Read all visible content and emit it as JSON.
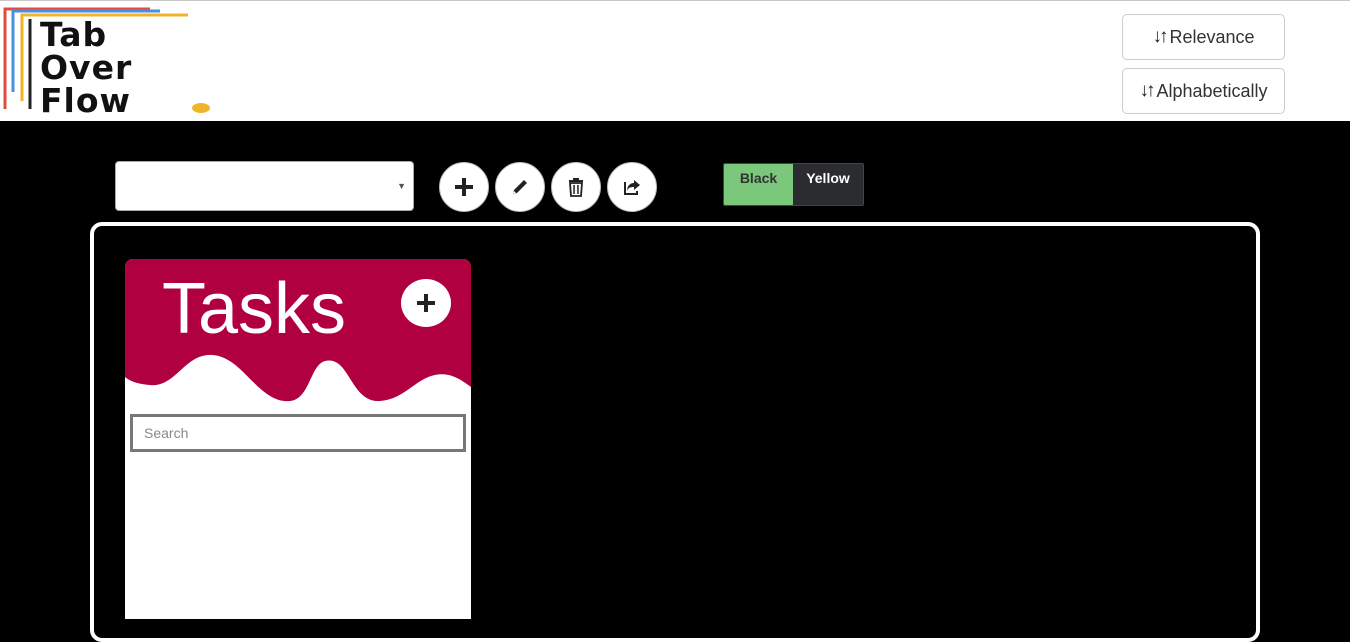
{
  "header": {
    "logo": {
      "line1": "Tab",
      "line2": "Over",
      "line3": "Flow",
      "dot_color": "#f0b429"
    },
    "sort_buttons": [
      {
        "label": "Relevance",
        "icon": "sort-icon"
      },
      {
        "label": "Alphabetically",
        "icon": "sort-icon"
      }
    ]
  },
  "toolbar": {
    "board_select": {
      "value": "",
      "icon": "chevron-down-icon"
    },
    "actions": [
      {
        "name": "add",
        "icon": "plus-icon"
      },
      {
        "name": "edit",
        "icon": "pencil-icon"
      },
      {
        "name": "delete",
        "icon": "trash-icon"
      },
      {
        "name": "share",
        "icon": "share-icon"
      }
    ],
    "theme_toggle": {
      "options": [
        "Black",
        "Yellow"
      ],
      "selected": "Black",
      "colors": {
        "selected_bg": "#7bc77b",
        "unselected_bg": "#2a2c30"
      }
    }
  },
  "board": {
    "columns": [
      {
        "title": "Tasks",
        "header_color": "#b00040",
        "add_icon": "plus-icon",
        "search": {
          "placeholder": "Search",
          "value": ""
        },
        "items": []
      }
    ]
  }
}
